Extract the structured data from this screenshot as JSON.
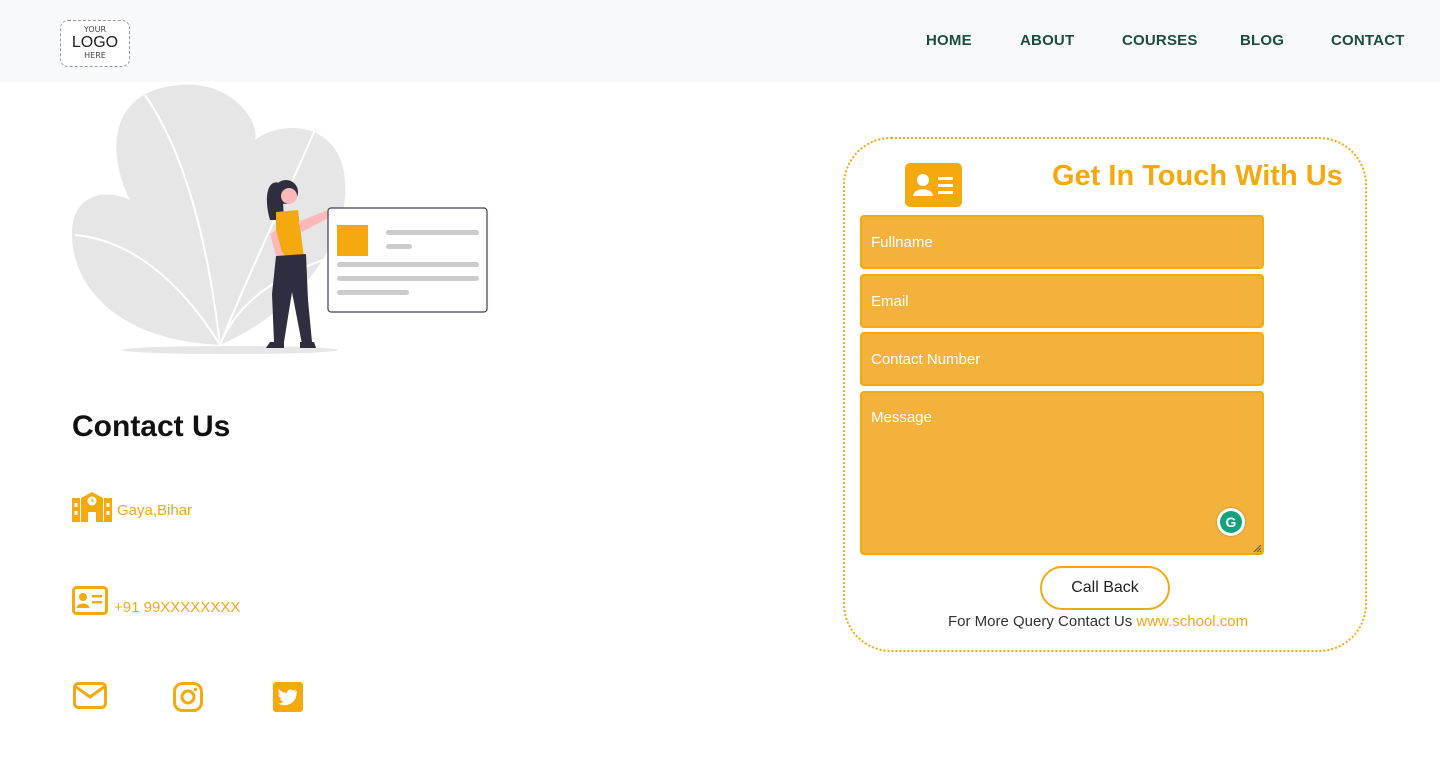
{
  "logo": {
    "line1": "YOUR",
    "line2": "LOGO",
    "line3": "HERE"
  },
  "nav": {
    "items": [
      {
        "label": "HOME"
      },
      {
        "label": "ABOUT"
      },
      {
        "label": "COURSES"
      },
      {
        "label": "BLOG"
      },
      {
        "label": "CONTACT"
      }
    ]
  },
  "contact": {
    "title": "Contact Us",
    "address": "Gaya,Bihar",
    "phone": "+91 99XXXXXXXX",
    "social_icons": [
      "mail-icon",
      "instagram-icon",
      "twitter-icon"
    ]
  },
  "form": {
    "title": "Get In Touch With Us",
    "fields": {
      "fullname_placeholder": "Fullname",
      "email_placeholder": "Email",
      "contact_placeholder": "Contact Number",
      "message_placeholder": "Message"
    },
    "submit_label": "Call Back",
    "footer_text": "For More Query Contact Us",
    "footer_link": "www.school.com"
  },
  "colors": {
    "accent": "#f5a90f",
    "field_bg": "#f3b23c",
    "nav_text": "#1b4d3e",
    "header_bg": "#f8f9fa"
  }
}
